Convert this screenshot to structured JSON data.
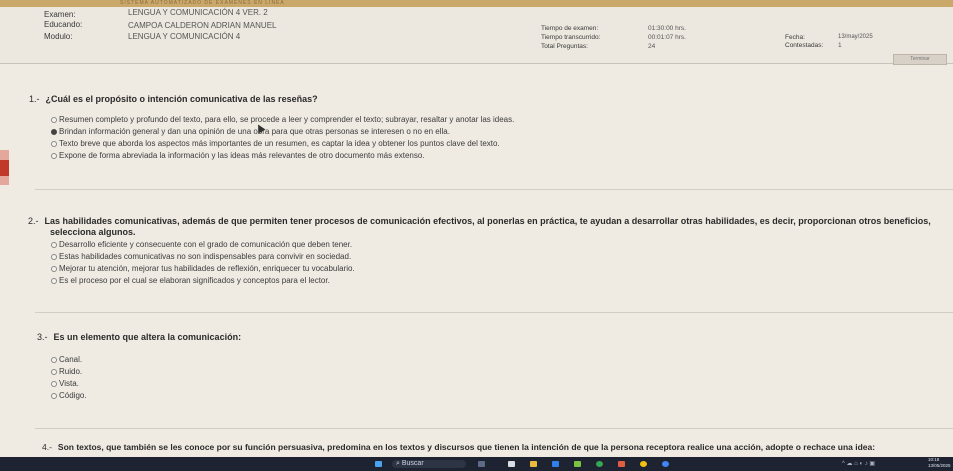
{
  "header": {
    "top_strip_text": "SISTEMA AUTOMATIZADO DE EXÁMENES EN LÍNEA",
    "exam_label": "Examen:",
    "exam_value": "LENGUA Y COMUNICACIÓN 4 VER. 2",
    "student_label": "Educando:",
    "student_value": "CAMPOA CALDERON ADRIAN MANUEL",
    "module_label": "Modulo:",
    "module_value": "LENGUA Y COMUNICACIÓN 4",
    "exam_time_label": "Tiempo de examen:",
    "exam_time_value": "01:30:00 hrs.",
    "elapsed_label": "Tiempo transcurrido:",
    "elapsed_value": "00:01:07 hrs.",
    "total_label": "Total Preguntas:",
    "total_value": "24",
    "date_label": "Fecha:",
    "date_value": "13/may/2025",
    "answered_label": "Contestadas:",
    "answered_value": "1",
    "finish_button": "Terminar"
  },
  "questions": [
    {
      "number": "1.-",
      "text": "¿Cuál es el propósito o intención comunicativa de las reseñas?",
      "options": [
        {
          "label": "Resumen completo y profundo del texto, para ello, se procede a leer y comprender el texto; subrayar, resaltar y anotar las ideas.",
          "checked": false
        },
        {
          "label": "Brindan información general y dan una opinión de una obra para que otras personas se interesen o no en ella.",
          "checked": true
        },
        {
          "label": "Texto breve que aborda los aspectos más importantes de un resumen, es captar la idea y obtener los puntos clave del texto.",
          "checked": false
        },
        {
          "label": "Expone de forma abreviada la información y las ideas más relevantes de otro documento más extenso.",
          "checked": false
        }
      ]
    },
    {
      "number": "2.-",
      "text": "Las habilidades comunicativas, además de que permiten tener procesos de comunicación efectivos, al ponerlas en práctica, te ayudan a desarrollar otras habilidades, es decir, proporcionan otros beneficios,",
      "text_line2": "selecciona algunos.",
      "options": [
        {
          "label": "Desarrollo eficiente y consecuente con el grado de comunicación que deben tener.",
          "checked": false
        },
        {
          "label": "Estas habilidades comunicativas no son indispensables para convivir en sociedad.",
          "checked": false
        },
        {
          "label": "Mejorar tu atención, mejorar tus habilidades de reflexión, enriquecer tu vocabulario.",
          "checked": false
        },
        {
          "label": "Es el proceso por el cual se elaboran significados y conceptos para el lector.",
          "checked": false
        }
      ]
    },
    {
      "number": "3.-",
      "text": "Es un elemento que altera la comunicación:",
      "options": [
        {
          "label": "Canal.",
          "checked": false
        },
        {
          "label": "Ruido.",
          "checked": false
        },
        {
          "label": "Vista.",
          "checked": false
        },
        {
          "label": "Código.",
          "checked": false
        }
      ]
    },
    {
      "number": "4.-",
      "text": "Son textos, que también se les conoce por su función persuasiva, predomina en los textos y discursos que tienen la intención de que la persona receptora realice una acción, adopte o rechace una idea:",
      "options": []
    }
  ],
  "taskbar": {
    "search_label": "Buscar",
    "clock_time": "10:18",
    "clock_date": "13/05/2025"
  },
  "colors": {
    "page_bg": "#efeae2",
    "top_strip": "#c9a86a",
    "taskbar": "#1d2330",
    "left_bar_accent": "#c0392b"
  }
}
